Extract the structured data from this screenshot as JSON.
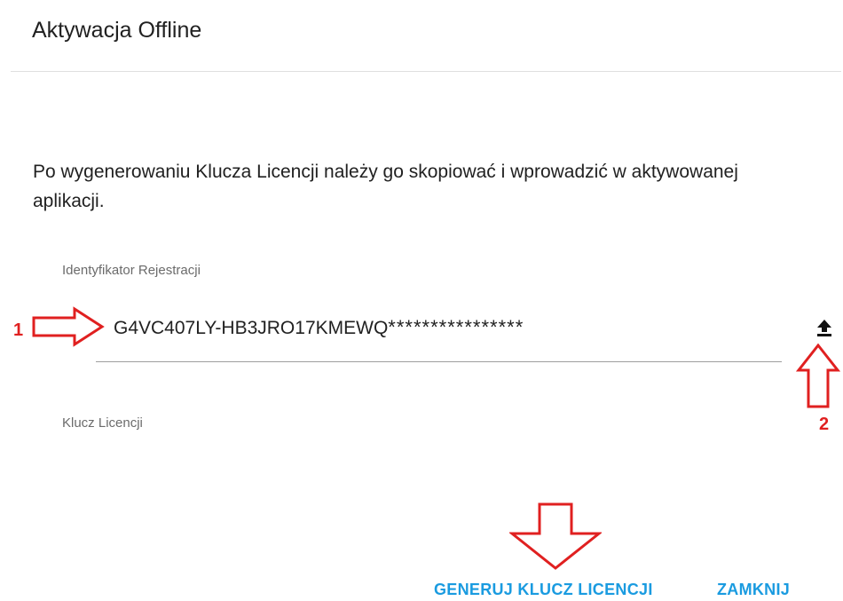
{
  "dialog": {
    "title": "Aktywacja Offline",
    "description": "Po wygenerowaniu Klucza Licencji należy go skopiować i wprowadzić w aktywowanej aplikacji."
  },
  "registration_field": {
    "label": "Identyfikator Rejestracji",
    "value": "G4VC407LY-HB3JRO17KMEWQ",
    "masked_suffix": "****************",
    "action_icon": "upload-icon"
  },
  "license_field": {
    "label": "Klucz Licencji",
    "value": ""
  },
  "actions": {
    "generate_label": "GENERUJ KLUCZ LICENCJI",
    "close_label": "ZAMKNIJ"
  },
  "annotations": {
    "marker_1": "1",
    "marker_2": "2",
    "color": "#e02020"
  },
  "colors": {
    "accent": "#1a9be0",
    "text": "#212121",
    "label": "#6b6b6b"
  }
}
